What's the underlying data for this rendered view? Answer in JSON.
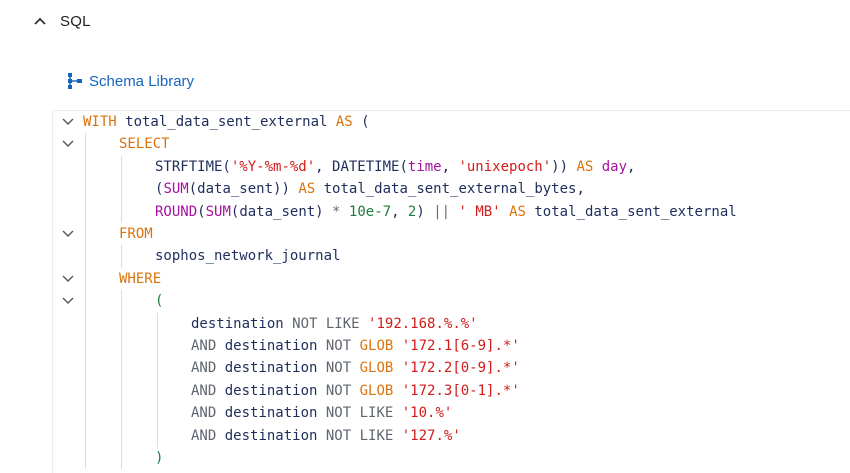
{
  "section": {
    "title": "SQL",
    "expanded": true
  },
  "schema_library": {
    "label": "Schema Library"
  },
  "editor": {
    "lines": [
      {
        "fold": true,
        "indent": 0,
        "tokens": [
          [
            "kw",
            "WITH"
          ],
          [
            "id",
            " total_data_sent_external "
          ],
          [
            "kw",
            "AS"
          ],
          [
            "pn",
            " ("
          ]
        ]
      },
      {
        "fold": true,
        "indent": 1,
        "tokens": [
          [
            "kw",
            "SELECT"
          ]
        ]
      },
      {
        "fold": false,
        "indent": 2,
        "tokens": [
          [
            "id",
            "STRFTIME("
          ],
          [
            "str",
            "'%Y-%m-%d'"
          ],
          [
            "id",
            ", DATETIME("
          ],
          [
            "fn",
            "time"
          ],
          [
            "id",
            ", "
          ],
          [
            "str",
            "'unixepoch'"
          ],
          [
            "id",
            ")) "
          ],
          [
            "kw",
            "AS"
          ],
          [
            "fn",
            " day"
          ],
          [
            "id",
            ","
          ]
        ]
      },
      {
        "fold": false,
        "indent": 2,
        "tokens": [
          [
            "id",
            "("
          ],
          [
            "fn",
            "SUM"
          ],
          [
            "id",
            "(data_sent)) "
          ],
          [
            "kw",
            "AS"
          ],
          [
            "id",
            " total_data_sent_external_bytes,"
          ]
        ]
      },
      {
        "fold": false,
        "indent": 2,
        "tokens": [
          [
            "fn",
            "ROUND"
          ],
          [
            "id",
            "("
          ],
          [
            "fn",
            "SUM"
          ],
          [
            "id",
            "(data_sent) "
          ],
          [
            "op",
            "*"
          ],
          [
            "num",
            " 10e-7"
          ],
          [
            "id",
            ", "
          ],
          [
            "num",
            "2"
          ],
          [
            "id",
            ") "
          ],
          [
            "op",
            "||"
          ],
          [
            "str",
            " ' MB'"
          ],
          [
            "kw",
            " AS"
          ],
          [
            "id",
            " total_data_sent_external"
          ]
        ]
      },
      {
        "fold": true,
        "indent": 1,
        "tokens": [
          [
            "kw",
            "FROM"
          ]
        ]
      },
      {
        "fold": false,
        "indent": 2,
        "tokens": [
          [
            "id",
            "sophos_network_journal"
          ]
        ]
      },
      {
        "fold": true,
        "indent": 1,
        "tokens": [
          [
            "kw",
            "WHERE"
          ]
        ]
      },
      {
        "fold": true,
        "indent": 2,
        "tokens": [
          [
            "num",
            "("
          ]
        ]
      },
      {
        "fold": false,
        "indent": 3,
        "tokens": [
          [
            "id",
            "destination "
          ],
          [
            "gr",
            "NOT"
          ],
          [
            "gr",
            " LIKE"
          ],
          [
            "str",
            " '192.168.%.%'"
          ]
        ]
      },
      {
        "fold": false,
        "indent": 3,
        "tokens": [
          [
            "gr",
            "AND"
          ],
          [
            "id",
            " destination "
          ],
          [
            "gr",
            "NOT"
          ],
          [
            "kw",
            " GLOB"
          ],
          [
            "str",
            " '172.1[6-9].*'"
          ]
        ]
      },
      {
        "fold": false,
        "indent": 3,
        "tokens": [
          [
            "gr",
            "AND"
          ],
          [
            "id",
            " destination "
          ],
          [
            "gr",
            "NOT"
          ],
          [
            "kw",
            " GLOB"
          ],
          [
            "str",
            " '172.2[0-9].*'"
          ]
        ]
      },
      {
        "fold": false,
        "indent": 3,
        "tokens": [
          [
            "gr",
            "AND"
          ],
          [
            "id",
            " destination "
          ],
          [
            "gr",
            "NOT"
          ],
          [
            "kw",
            " GLOB"
          ],
          [
            "str",
            " '172.3[0-1].*'"
          ]
        ]
      },
      {
        "fold": false,
        "indent": 3,
        "tokens": [
          [
            "gr",
            "AND"
          ],
          [
            "id",
            " destination "
          ],
          [
            "gr",
            "NOT"
          ],
          [
            "gr",
            " LIKE"
          ],
          [
            "str",
            " '10.%'"
          ]
        ]
      },
      {
        "fold": false,
        "indent": 3,
        "tokens": [
          [
            "gr",
            "AND"
          ],
          [
            "id",
            " destination "
          ],
          [
            "gr",
            "NOT"
          ],
          [
            "gr",
            " LIKE"
          ],
          [
            "str",
            " '127.%'"
          ]
        ]
      },
      {
        "fold": false,
        "indent": 2,
        "tokens": [
          [
            "num",
            ")"
          ]
        ]
      }
    ]
  },
  "colors": {
    "keyword": "#d9730d",
    "function": "#a4139f",
    "string": "#d21b1b",
    "number": "#1d7a3a",
    "link": "#1565c0",
    "identifier": "#1f2d5c"
  }
}
